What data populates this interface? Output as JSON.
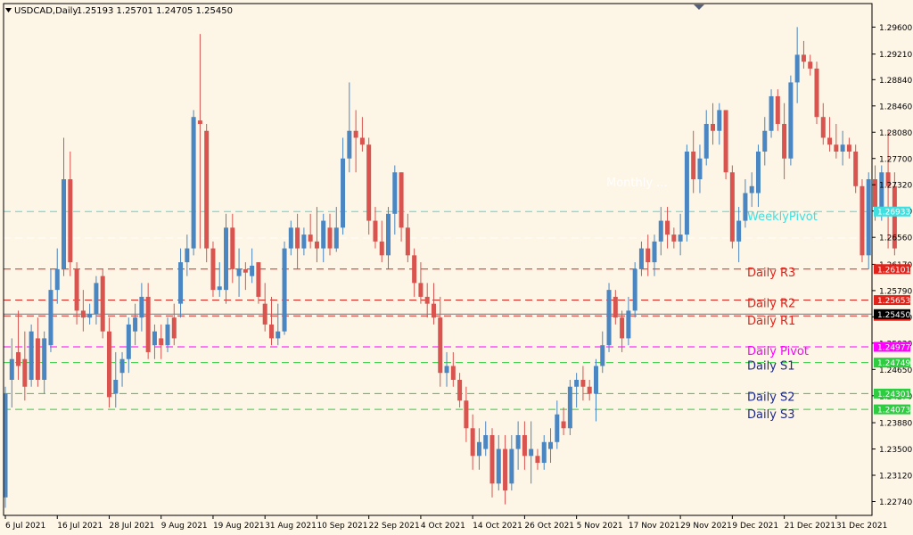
{
  "header": {
    "symbol": "USDCAD,Daily",
    "ohlc": "1.25193 1.25701 1.24705 1.25450"
  },
  "colors": {
    "background": "#fdf5e6",
    "bull": "#4a86c1",
    "bear": "#d9534f",
    "frame": "#000000",
    "resistance": "#e0241b",
    "pivot": "#ff00ff",
    "support": "#2ecc40",
    "weekly_pivot": "#40e0e0",
    "monthly": "#ffffff",
    "support_label": "#1e2a8c"
  },
  "chart_data": {
    "type": "candlestick",
    "title": "",
    "price_range": [
      1.2254,
      1.2994
    ],
    "y_ticks": [
      "1.29600",
      "1.29210",
      "1.28840",
      "1.28460",
      "1.28080",
      "1.27700",
      "1.27320",
      "1.26940",
      "1.26560",
      "1.26170",
      "1.25790",
      "1.25410",
      "1.25030",
      "1.24650",
      "1.24270",
      "1.23880",
      "1.23500",
      "1.23120",
      "1.22740"
    ],
    "x_labels": [
      {
        "label": "6 Jul 2021",
        "index": 0
      },
      {
        "label": "16 Jul 2021",
        "index": 8
      },
      {
        "label": "28 Jul 2021",
        "index": 16
      },
      {
        "label": "9 Aug 2021",
        "index": 24
      },
      {
        "label": "19 Aug 2021",
        "index": 32
      },
      {
        "label": "31 Aug 2021",
        "index": 40
      },
      {
        "label": "10 Sep 2021",
        "index": 48
      },
      {
        "label": "22 Sep 2021",
        "index": 56
      },
      {
        "label": "4 Oct 2021",
        "index": 64
      },
      {
        "label": "14 Oct 2021",
        "index": 72
      },
      {
        "label": "26 Oct 2021",
        "index": 80
      },
      {
        "label": "5 Nov 2021",
        "index": 88
      },
      {
        "label": "17 Nov 2021",
        "index": 96
      },
      {
        "label": "29 Nov 2021",
        "index": 104
      },
      {
        "label": "9 Dec 2021",
        "index": 112
      },
      {
        "label": "21 Dec 2021",
        "index": 120
      },
      {
        "label": "31 Dec 2021",
        "index": 128
      }
    ],
    "candles": [
      {
        "o": 1.228,
        "h": 1.244,
        "l": 1.2265,
        "c": 1.243
      },
      {
        "o": 1.245,
        "h": 1.251,
        "l": 1.241,
        "c": 1.248
      },
      {
        "o": 1.249,
        "h": 1.255,
        "l": 1.245,
        "c": 1.247
      },
      {
        "o": 1.248,
        "h": 1.252,
        "l": 1.242,
        "c": 1.244
      },
      {
        "o": 1.245,
        "h": 1.253,
        "l": 1.244,
        "c": 1.252
      },
      {
        "o": 1.251,
        "h": 1.254,
        "l": 1.244,
        "c": 1.245
      },
      {
        "o": 1.245,
        "h": 1.252,
        "l": 1.243,
        "c": 1.251
      },
      {
        "o": 1.25,
        "h": 1.261,
        "l": 1.249,
        "c": 1.258
      },
      {
        "o": 1.258,
        "h": 1.264,
        "l": 1.256,
        "c": 1.261
      },
      {
        "o": 1.261,
        "h": 1.28,
        "l": 1.26,
        "c": 1.274
      },
      {
        "o": 1.274,
        "h": 1.278,
        "l": 1.26,
        "c": 1.262
      },
      {
        "o": 1.261,
        "h": 1.262,
        "l": 1.253,
        "c": 1.255
      },
      {
        "o": 1.255,
        "h": 1.258,
        "l": 1.252,
        "c": 1.254
      },
      {
        "o": 1.254,
        "h": 1.256,
        "l": 1.253,
        "c": 1.2545
      },
      {
        "o": 1.2545,
        "h": 1.26,
        "l": 1.253,
        "c": 1.259
      },
      {
        "o": 1.26,
        "h": 1.261,
        "l": 1.251,
        "c": 1.252
      },
      {
        "o": 1.252,
        "h": 1.254,
        "l": 1.241,
        "c": 1.2425
      },
      {
        "o": 1.243,
        "h": 1.249,
        "l": 1.241,
        "c": 1.245
      },
      {
        "o": 1.246,
        "h": 1.249,
        "l": 1.244,
        "c": 1.248
      },
      {
        "o": 1.248,
        "h": 1.254,
        "l": 1.246,
        "c": 1.253
      },
      {
        "o": 1.252,
        "h": 1.256,
        "l": 1.25,
        "c": 1.254
      },
      {
        "o": 1.254,
        "h": 1.259,
        "l": 1.252,
        "c": 1.257
      },
      {
        "o": 1.257,
        "h": 1.259,
        "l": 1.248,
        "c": 1.249
      },
      {
        "o": 1.25,
        "h": 1.253,
        "l": 1.248,
        "c": 1.252
      },
      {
        "o": 1.251,
        "h": 1.253,
        "l": 1.248,
        "c": 1.25
      },
      {
        "o": 1.25,
        "h": 1.254,
        "l": 1.249,
        "c": 1.253
      },
      {
        "o": 1.254,
        "h": 1.256,
        "l": 1.25,
        "c": 1.251
      },
      {
        "o": 1.256,
        "h": 1.264,
        "l": 1.254,
        "c": 1.262
      },
      {
        "o": 1.262,
        "h": 1.266,
        "l": 1.26,
        "c": 1.264
      },
      {
        "o": 1.264,
        "h": 1.284,
        "l": 1.263,
        "c": 1.283
      },
      {
        "o": 1.2825,
        "h": 1.295,
        "l": 1.264,
        "c": 1.282
      },
      {
        "o": 1.281,
        "h": 1.282,
        "l": 1.262,
        "c": 1.264
      },
      {
        "o": 1.264,
        "h": 1.265,
        "l": 1.257,
        "c": 1.258
      },
      {
        "o": 1.258,
        "h": 1.262,
        "l": 1.257,
        "c": 1.2585
      },
      {
        "o": 1.258,
        "h": 1.269,
        "l": 1.256,
        "c": 1.267
      },
      {
        "o": 1.267,
        "h": 1.269,
        "l": 1.259,
        "c": 1.261
      },
      {
        "o": 1.26,
        "h": 1.264,
        "l": 1.257,
        "c": 1.261
      },
      {
        "o": 1.261,
        "h": 1.262,
        "l": 1.258,
        "c": 1.2605
      },
      {
        "o": 1.26,
        "h": 1.264,
        "l": 1.259,
        "c": 1.2615
      },
      {
        "o": 1.262,
        "h": 1.262,
        "l": 1.256,
        "c": 1.257
      },
      {
        "o": 1.256,
        "h": 1.259,
        "l": 1.252,
        "c": 1.253
      },
      {
        "o": 1.253,
        "h": 1.257,
        "l": 1.25,
        "c": 1.251
      },
      {
        "o": 1.251,
        "h": 1.256,
        "l": 1.25,
        "c": 1.252
      },
      {
        "o": 1.252,
        "h": 1.265,
        "l": 1.2515,
        "c": 1.264
      },
      {
        "o": 1.264,
        "h": 1.268,
        "l": 1.263,
        "c": 1.267
      },
      {
        "o": 1.267,
        "h": 1.269,
        "l": 1.261,
        "c": 1.264
      },
      {
        "o": 1.264,
        "h": 1.267,
        "l": 1.263,
        "c": 1.266
      },
      {
        "o": 1.266,
        "h": 1.269,
        "l": 1.264,
        "c": 1.265
      },
      {
        "o": 1.265,
        "h": 1.27,
        "l": 1.262,
        "c": 1.264
      },
      {
        "o": 1.264,
        "h": 1.269,
        "l": 1.262,
        "c": 1.268
      },
      {
        "o": 1.267,
        "h": 1.269,
        "l": 1.263,
        "c": 1.264
      },
      {
        "o": 1.264,
        "h": 1.27,
        "l": 1.2635,
        "c": 1.267
      },
      {
        "o": 1.267,
        "h": 1.28,
        "l": 1.266,
        "c": 1.277
      },
      {
        "o": 1.277,
        "h": 1.288,
        "l": 1.275,
        "c": 1.281
      },
      {
        "o": 1.281,
        "h": 1.284,
        "l": 1.275,
        "c": 1.28
      },
      {
        "o": 1.28,
        "h": 1.283,
        "l": 1.278,
        "c": 1.279
      },
      {
        "o": 1.279,
        "h": 1.28,
        "l": 1.266,
        "c": 1.268
      },
      {
        "o": 1.268,
        "h": 1.27,
        "l": 1.264,
        "c": 1.265
      },
      {
        "o": 1.265,
        "h": 1.268,
        "l": 1.262,
        "c": 1.263
      },
      {
        "o": 1.263,
        "h": 1.27,
        "l": 1.261,
        "c": 1.269
      },
      {
        "o": 1.269,
        "h": 1.276,
        "l": 1.266,
        "c": 1.275
      },
      {
        "o": 1.275,
        "h": 1.275,
        "l": 1.265,
        "c": 1.267
      },
      {
        "o": 1.267,
        "h": 1.269,
        "l": 1.262,
        "c": 1.263
      },
      {
        "o": 1.263,
        "h": 1.264,
        "l": 1.257,
        "c": 1.259
      },
      {
        "o": 1.259,
        "h": 1.262,
        "l": 1.256,
        "c": 1.257
      },
      {
        "o": 1.257,
        "h": 1.259,
        "l": 1.254,
        "c": 1.256
      },
      {
        "o": 1.256,
        "h": 1.259,
        "l": 1.253,
        "c": 1.254
      },
      {
        "o": 1.254,
        "h": 1.257,
        "l": 1.244,
        "c": 1.246
      },
      {
        "o": 1.246,
        "h": 1.249,
        "l": 1.244,
        "c": 1.247
      },
      {
        "o": 1.247,
        "h": 1.249,
        "l": 1.244,
        "c": 1.245
      },
      {
        "o": 1.245,
        "h": 1.246,
        "l": 1.241,
        "c": 1.242
      },
      {
        "o": 1.242,
        "h": 1.244,
        "l": 1.236,
        "c": 1.238
      },
      {
        "o": 1.238,
        "h": 1.24,
        "l": 1.232,
        "c": 1.234
      },
      {
        "o": 1.234,
        "h": 1.238,
        "l": 1.232,
        "c": 1.236
      },
      {
        "o": 1.235,
        "h": 1.239,
        "l": 1.234,
        "c": 1.237
      },
      {
        "o": 1.237,
        "h": 1.238,
        "l": 1.228,
        "c": 1.23
      },
      {
        "o": 1.23,
        "h": 1.237,
        "l": 1.229,
        "c": 1.235
      },
      {
        "o": 1.235,
        "h": 1.237,
        "l": 1.227,
        "c": 1.229
      },
      {
        "o": 1.23,
        "h": 1.237,
        "l": 1.229,
        "c": 1.235
      },
      {
        "o": 1.235,
        "h": 1.239,
        "l": 1.232,
        "c": 1.237
      },
      {
        "o": 1.237,
        "h": 1.239,
        "l": 1.232,
        "c": 1.234
      },
      {
        "o": 1.234,
        "h": 1.239,
        "l": 1.23,
        "c": 1.235
      },
      {
        "o": 1.234,
        "h": 1.235,
        "l": 1.232,
        "c": 1.233
      },
      {
        "o": 1.233,
        "h": 1.237,
        "l": 1.232,
        "c": 1.236
      },
      {
        "o": 1.235,
        "h": 1.238,
        "l": 1.233,
        "c": 1.236
      },
      {
        "o": 1.236,
        "h": 1.242,
        "l": 1.235,
        "c": 1.24
      },
      {
        "o": 1.239,
        "h": 1.241,
        "l": 1.237,
        "c": 1.238
      },
      {
        "o": 1.238,
        "h": 1.245,
        "l": 1.237,
        "c": 1.244
      },
      {
        "o": 1.244,
        "h": 1.246,
        "l": 1.241,
        "c": 1.245
      },
      {
        "o": 1.245,
        "h": 1.247,
        "l": 1.242,
        "c": 1.244
      },
      {
        "o": 1.244,
        "h": 1.245,
        "l": 1.242,
        "c": 1.243
      },
      {
        "o": 1.243,
        "h": 1.248,
        "l": 1.239,
        "c": 1.247
      },
      {
        "o": 1.247,
        "h": 1.252,
        "l": 1.246,
        "c": 1.25
      },
      {
        "o": 1.25,
        "h": 1.259,
        "l": 1.249,
        "c": 1.258
      },
      {
        "o": 1.257,
        "h": 1.258,
        "l": 1.253,
        "c": 1.254
      },
      {
        "o": 1.254,
        "h": 1.255,
        "l": 1.249,
        "c": 1.251
      },
      {
        "o": 1.251,
        "h": 1.257,
        "l": 1.25,
        "c": 1.255
      },
      {
        "o": 1.255,
        "h": 1.262,
        "l": 1.254,
        "c": 1.261
      },
      {
        "o": 1.261,
        "h": 1.265,
        "l": 1.26,
        "c": 1.264
      },
      {
        "o": 1.264,
        "h": 1.266,
        "l": 1.26,
        "c": 1.262
      },
      {
        "o": 1.262,
        "h": 1.266,
        "l": 1.26,
        "c": 1.265
      },
      {
        "o": 1.265,
        "h": 1.27,
        "l": 1.263,
        "c": 1.268
      },
      {
        "o": 1.268,
        "h": 1.27,
        "l": 1.264,
        "c": 1.266
      },
      {
        "o": 1.266,
        "h": 1.267,
        "l": 1.264,
        "c": 1.265
      },
      {
        "o": 1.265,
        "h": 1.269,
        "l": 1.263,
        "c": 1.266
      },
      {
        "o": 1.266,
        "h": 1.279,
        "l": 1.265,
        "c": 1.278
      },
      {
        "o": 1.278,
        "h": 1.281,
        "l": 1.272,
        "c": 1.274
      },
      {
        "o": 1.274,
        "h": 1.279,
        "l": 1.272,
        "c": 1.277
      },
      {
        "o": 1.277,
        "h": 1.284,
        "l": 1.276,
        "c": 1.282
      },
      {
        "o": 1.282,
        "h": 1.285,
        "l": 1.279,
        "c": 1.281
      },
      {
        "o": 1.281,
        "h": 1.285,
        "l": 1.279,
        "c": 1.284
      },
      {
        "o": 1.284,
        "h": 1.284,
        "l": 1.274,
        "c": 1.275
      },
      {
        "o": 1.275,
        "h": 1.276,
        "l": 1.264,
        "c": 1.265
      },
      {
        "o": 1.265,
        "h": 1.27,
        "l": 1.262,
        "c": 1.268
      },
      {
        "o": 1.268,
        "h": 1.274,
        "l": 1.267,
        "c": 1.272
      },
      {
        "o": 1.272,
        "h": 1.275,
        "l": 1.27,
        "c": 1.273
      },
      {
        "o": 1.272,
        "h": 1.279,
        "l": 1.27,
        "c": 1.278
      },
      {
        "o": 1.278,
        "h": 1.283,
        "l": 1.276,
        "c": 1.281
      },
      {
        "o": 1.281,
        "h": 1.287,
        "l": 1.28,
        "c": 1.286
      },
      {
        "o": 1.286,
        "h": 1.287,
        "l": 1.281,
        "c": 1.282
      },
      {
        "o": 1.282,
        "h": 1.285,
        "l": 1.274,
        "c": 1.277
      },
      {
        "o": 1.277,
        "h": 1.289,
        "l": 1.276,
        "c": 1.288
      },
      {
        "o": 1.288,
        "h": 1.296,
        "l": 1.285,
        "c": 1.292
      },
      {
        "o": 1.292,
        "h": 1.294,
        "l": 1.29,
        "c": 1.291
      },
      {
        "o": 1.291,
        "h": 1.292,
        "l": 1.289,
        "c": 1.29
      },
      {
        "o": 1.29,
        "h": 1.291,
        "l": 1.282,
        "c": 1.283
      },
      {
        "o": 1.283,
        "h": 1.285,
        "l": 1.279,
        "c": 1.28
      },
      {
        "o": 1.28,
        "h": 1.283,
        "l": 1.278,
        "c": 1.279
      },
      {
        "o": 1.279,
        "h": 1.282,
        "l": 1.277,
        "c": 1.278
      },
      {
        "o": 1.278,
        "h": 1.281,
        "l": 1.276,
        "c": 1.279
      },
      {
        "o": 1.279,
        "h": 1.28,
        "l": 1.277,
        "c": 1.278
      },
      {
        "o": 1.278,
        "h": 1.279,
        "l": 1.272,
        "c": 1.273
      },
      {
        "o": 1.273,
        "h": 1.274,
        "l": 1.262,
        "c": 1.263
      },
      {
        "o": 1.263,
        "h": 1.275,
        "l": 1.261,
        "c": 1.274
      },
      {
        "o": 1.274,
        "h": 1.276,
        "l": 1.268,
        "c": 1.27
      },
      {
        "o": 1.27,
        "h": 1.276,
        "l": 1.268,
        "c": 1.275
      },
      {
        "o": 1.275,
        "h": 1.281,
        "l": 1.264,
        "c": 1.273
      },
      {
        "o": 1.273,
        "h": 1.275,
        "l": 1.263,
        "c": 1.264
      }
    ],
    "levels": [
      {
        "name": "Daily R3",
        "price": 1.26101,
        "tag": "1.26101",
        "color": "#e0241b",
        "label_color": "#e0241b",
        "style": "dash",
        "label_offset": 8
      },
      {
        "name": "Daily R2",
        "price": 1.25653,
        "tag": "1.25653",
        "color": "#e0241b",
        "label_color": "#e0241b",
        "style": "dash",
        "label_offset": 8
      },
      {
        "name": "Daily R1",
        "price": 1.25425,
        "tag": "1.25425",
        "color": "#e0241b",
        "label_color": "#e0241b",
        "style": "dash",
        "label_offset": 10
      },
      {
        "name": "Daily Pivot",
        "price": 1.24977,
        "tag": "1.24977",
        "color": "#ff00ff",
        "label_color": "#ff00ff",
        "style": "dash",
        "label_offset": 9
      },
      {
        "name": "Daily S1",
        "price": 1.24749,
        "tag": "1.24749",
        "color": "#2ecc40",
        "label_color": "#1e2a8c",
        "style": "dash",
        "label_offset": 8
      },
      {
        "name": "Daily S2",
        "price": 1.24301,
        "tag": "1.24301",
        "color": "#2ecc40",
        "label_color": "#1e2a8c",
        "style": "dash",
        "label_offset": 8
      },
      {
        "name": "Daily S3",
        "price": 1.24073,
        "tag": "1.24073",
        "color": "#2ecc40",
        "label_color": "#1e2a8c",
        "style": "dash",
        "label_offset": 10
      },
      {
        "name": "WeeklyPivot",
        "price": 1.26933,
        "tag": "1.26933",
        "color": "#40e0e0",
        "label_color": "#40e0e0",
        "style": "dash",
        "label_offset": 10
      },
      {
        "name": "Monthly ...",
        "price": 1.2655,
        "tag": "",
        "color": "#ffffff",
        "label_color": "#ffffff",
        "style": "dash",
        "label_offset": -58
      }
    ],
    "current_price": {
      "price": 1.2545,
      "tag": "1.25450"
    }
  }
}
